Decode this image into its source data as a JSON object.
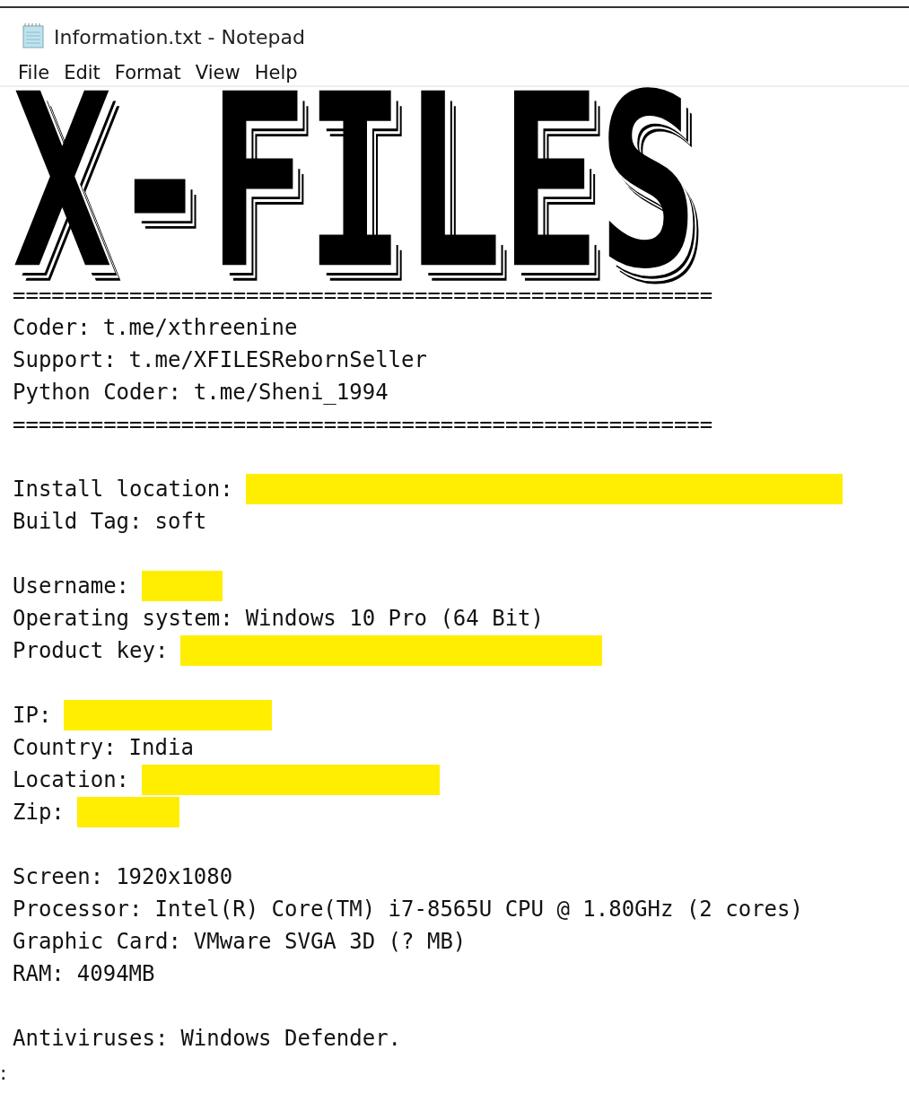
{
  "window": {
    "title": "Information.txt - Notepad"
  },
  "menu": [
    "File",
    "Edit",
    "Format",
    "View",
    "Help"
  ],
  "logo": {
    "text": "X-FILES"
  },
  "lines": [
    {
      "kind": "separator",
      "text": "======================================================"
    },
    {
      "kind": "field",
      "label": "Coder:",
      "value": "t.me/xthreenine",
      "redacted": false
    },
    {
      "kind": "field",
      "label": "Support:",
      "value": "t.me/XFILESRebornSeller",
      "redacted": false
    },
    {
      "kind": "field",
      "label": "Python Coder:",
      "value": "t.me/Sheni_1994",
      "redacted": false
    },
    {
      "kind": "separator",
      "text": "======================================================"
    },
    {
      "kind": "blank"
    },
    {
      "kind": "field",
      "label": "Install location:",
      "redacted": true
    },
    {
      "kind": "field",
      "label": "Build Tag:",
      "value": "soft",
      "redacted": false
    },
    {
      "kind": "blank"
    },
    {
      "kind": "field",
      "label": "Username:",
      "redacted": true
    },
    {
      "kind": "field",
      "label": "Operating system:",
      "value": "Windows 10 Pro (64 Bit)",
      "redacted": false
    },
    {
      "kind": "field",
      "label": "Product key:",
      "redacted": true
    },
    {
      "kind": "blank"
    },
    {
      "kind": "field",
      "label": "IP:",
      "redacted": true
    },
    {
      "kind": "field",
      "label": "Country:",
      "value": "India",
      "redacted": false
    },
    {
      "kind": "field",
      "label": "Location:",
      "redacted": true
    },
    {
      "kind": "field",
      "label": "Zip:",
      "redacted": true
    },
    {
      "kind": "blank"
    },
    {
      "kind": "field",
      "label": "Screen:",
      "value": "1920x1080",
      "redacted": false
    },
    {
      "kind": "field",
      "label": "Processor:",
      "value": "Intel(R) Core(TM) i7-8565U CPU @ 1.80GHz (2 cores)",
      "redacted": false
    },
    {
      "kind": "field",
      "label": "Graphic Card:",
      "value": "VMware SVGA 3D (? MB)",
      "redacted": false
    },
    {
      "kind": "field",
      "label": "RAM:",
      "value": "4094MB",
      "redacted": false
    },
    {
      "kind": "blank"
    },
    {
      "kind": "field",
      "label": "Antiviruses:",
      "value": "Windows Defender.",
      "redacted": false
    }
  ],
  "stray_mark": ":"
}
